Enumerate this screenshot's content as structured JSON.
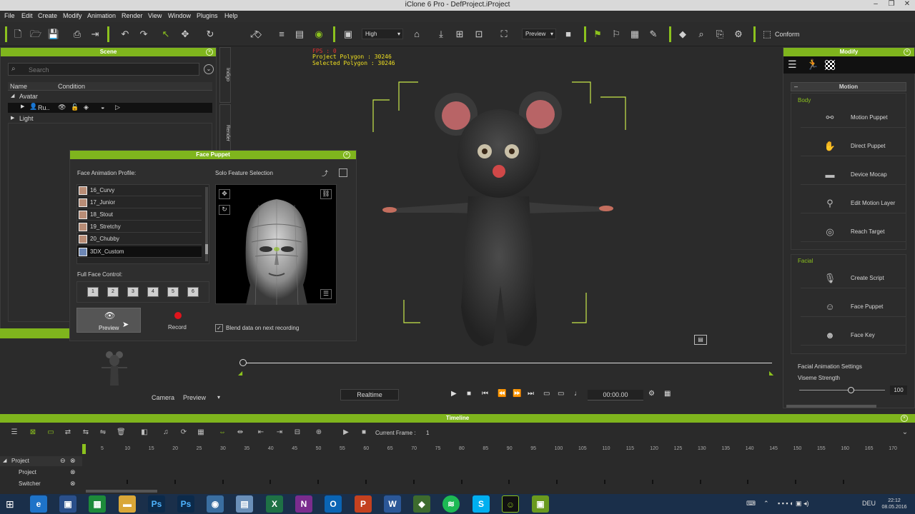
{
  "window": {
    "title": "iClone 6 Pro - DefProject.iProject"
  },
  "menu": [
    "File",
    "Edit",
    "Create",
    "Modify",
    "Animation",
    "Render",
    "View",
    "Window",
    "Plugins",
    "Help"
  ],
  "toolbar": {
    "quality": "High",
    "preview_mode": "Preview",
    "conform": "Conform"
  },
  "scene": {
    "title": "Scene",
    "search_placeholder": "Search",
    "col_name": "Name",
    "col_condition": "Condition",
    "tree": [
      {
        "label": "Avatar",
        "level": 0
      },
      {
        "label": "Ru..",
        "level": 1
      },
      {
        "label": "Light",
        "level": 0
      }
    ],
    "tabs": [
      "Indigo",
      "Render"
    ]
  },
  "face_puppet": {
    "title": "Face Puppet",
    "profile_label": "Face Animation Profile:",
    "solo_label": "Solo Feature Selection",
    "profiles": [
      "16_Curvy",
      "17_Junior",
      "18_Stout",
      "19_Stretchy",
      "20_Chubby",
      "3DX_Custom"
    ],
    "selected_profile": "3DX_Custom",
    "full_face_label": "Full Face Control:",
    "face_buttons": [
      "1",
      "2",
      "3",
      "4",
      "5",
      "6"
    ],
    "preview": "Preview",
    "record": "Record",
    "blend": "Blend data on next recording"
  },
  "viewport": {
    "fps": "FPS : 0",
    "project_polygon": "Project Polygon : 30246",
    "selected_polygon": "Selected Polygon : 30246"
  },
  "playback": {
    "camera_label": "Camera",
    "camera_value": "Preview",
    "realtime": "Realtime",
    "time": "00:00.00",
    "progress": 0
  },
  "modify": {
    "title": "Modify",
    "section": "Motion",
    "body_label": "Body",
    "body_items": [
      "Motion Puppet",
      "Direct Puppet",
      "Device Mocap",
      "Edit Motion Layer",
      "Reach Target"
    ],
    "facial_label": "Facial",
    "facial_items": [
      "Create Script",
      "Face Puppet",
      "Face Key"
    ],
    "settings_label": "Facial Animation Settings",
    "viseme_label": "Viseme Strength",
    "viseme_value": "100",
    "viseme_level": 0.6
  },
  "timeline": {
    "title": "Timeline",
    "current_frame_label": "Current Frame :",
    "current_frame": "1",
    "ticks": [
      "5",
      "10",
      "15",
      "20",
      "25",
      "30",
      "35",
      "40",
      "45",
      "50",
      "55",
      "60",
      "65",
      "70",
      "75",
      "80",
      "85",
      "90",
      "95",
      "100",
      "105",
      "110",
      "115",
      "120",
      "125",
      "130",
      "135",
      "140",
      "145",
      "150",
      "155",
      "160",
      "165",
      "170"
    ],
    "tracks": [
      "Project",
      "Project",
      "Switcher"
    ]
  },
  "taskbar": {
    "apps": [
      "e",
      "W",
      "X",
      "P",
      "P",
      "C",
      "",
      "X",
      "N",
      "O",
      "P",
      "W",
      "",
      "S",
      "S",
      "",
      ""
    ],
    "lang": "DEU",
    "time": "22:12",
    "date": "08.05.2016"
  }
}
